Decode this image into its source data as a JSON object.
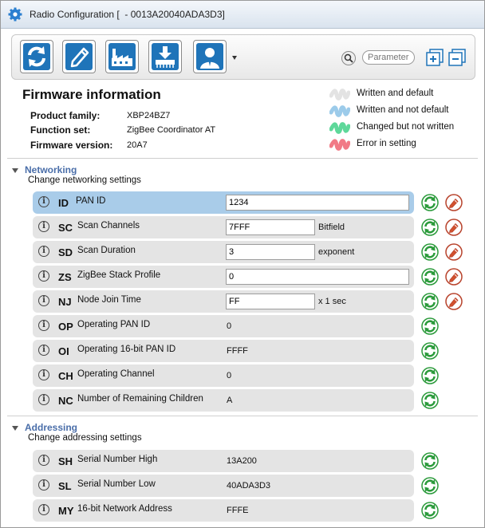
{
  "window": {
    "title": "Radio Configuration [  - 0013A20040ADA3D3]"
  },
  "toolbar": {
    "buttons": [
      {
        "icon": "read-refresh-icon"
      },
      {
        "icon": "write-pencil-icon"
      },
      {
        "icon": "factory-defaults-icon"
      },
      {
        "icon": "update-firmware-icon"
      },
      {
        "icon": "profile-user-icon"
      }
    ],
    "search_placeholder": "Parameter"
  },
  "firmware": {
    "title": "Firmware information",
    "product_family_label": "Product family:",
    "product_family": "XBP24BZ7",
    "function_set_label": "Function set:",
    "function_set": "ZigBee Coordinator AT",
    "firmware_version_label": "Firmware version:",
    "firmware_version": "20A7"
  },
  "legend": [
    {
      "label": "Written and default",
      "color": "#e3e3e3"
    },
    {
      "label": "Written and not default",
      "color": "#9ccbea"
    },
    {
      "label": "Changed but not written",
      "color": "#5ed89a"
    },
    {
      "label": "Error in setting",
      "color": "#f17a86"
    }
  ],
  "sections": {
    "networking": {
      "title": "Networking",
      "subtitle": "Change networking settings",
      "params": [
        {
          "code": "ID",
          "name": "PAN ID",
          "value": "1234",
          "editable": true,
          "unit": "",
          "selected": true
        },
        {
          "code": "SC",
          "name": "Scan Channels",
          "value": "7FFF",
          "editable": true,
          "unit": "Bitfield"
        },
        {
          "code": "SD",
          "name": "Scan Duration",
          "value": "3",
          "editable": true,
          "unit": "exponent"
        },
        {
          "code": "ZS",
          "name": "ZigBee Stack Profile",
          "value": "0",
          "editable": true,
          "unit": ""
        },
        {
          "code": "NJ",
          "name": "Node Join Time",
          "value": "FF",
          "editable": true,
          "unit": "x 1 sec"
        },
        {
          "code": "OP",
          "name": "Operating PAN ID",
          "value": "0",
          "editable": false
        },
        {
          "code": "OI",
          "name": "Operating 16-bit PAN ID",
          "value": "FFFF",
          "editable": false
        },
        {
          "code": "CH",
          "name": "Operating Channel",
          "value": "0",
          "editable": false
        },
        {
          "code": "NC",
          "name": "Number of Remaining Children",
          "value": "A",
          "editable": false
        }
      ]
    },
    "addressing": {
      "title": "Addressing",
      "subtitle": "Change addressing settings",
      "params": [
        {
          "code": "SH",
          "name": "Serial Number High",
          "value": "13A200",
          "editable": false
        },
        {
          "code": "SL",
          "name": "Serial Number Low",
          "value": "40ADA3D3",
          "editable": false
        },
        {
          "code": "MY",
          "name": "16-bit Network Address",
          "value": "FFFE",
          "editable": false
        }
      ]
    }
  }
}
